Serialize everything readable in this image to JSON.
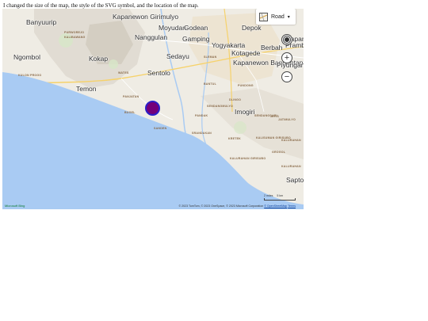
{
  "caption": "I changed the size of the map, the style of the SVG symbol, and the location of the map.",
  "map": {
    "style_picker_label": "Road",
    "labels": {
      "kapanewon_girimulyo": "Kapanewon Girimulyo",
      "banyuurip": "Banyuurip",
      "moyudan": "Moyudan",
      "godean": "Godean",
      "depok": "Depok",
      "kapanewon_partial": "Kapane",
      "nanggulan": "Nanggulan",
      "gamping": "Gamping",
      "yogyakarta": "Yogyakarta",
      "berbah": "Berbah",
      "prambanan_partial": "Pramba",
      "ngombol": "Ngombol",
      "kokap": "Kokap",
      "sedayu": "Sedayu",
      "kotagede": "Kotagede",
      "kapanewon_banguntapan": "Kapanewon Banguntapan",
      "piyungan_partial": "Piyungan",
      "sentolo": "Sentolo",
      "temon": "Temon",
      "imogiri": "Imogiri",
      "sapto_partial": "Sapto",
      "purworejo": "PURWOREJO",
      "kulon_progo": "KULON PROGO",
      "bantul": "BANTUL",
      "wates": "WATES",
      "panjatan": "PANJATAN",
      "bugel": "BUGEL",
      "pandak": "PANDAK",
      "sanden": "SANDEN",
      "srandakan": "SRANDAKAN",
      "kretek": "KRETEK",
      "pundong": "PUNDONG",
      "dlingo": "DLINGO",
      "jetis": "JETIS",
      "jatimulyo": "JATIMULYO",
      "kalisuman_girisubo": "KALISUMAN GIRISUBO",
      "kalurahan_girisubo": "KALURAHAN GIRISUBO",
      "kalurahan": "KALURAHAN",
      "kalurahan2": "KALURAHAN",
      "sleman": "SLEMAN",
      "kalibawang": "KALIBAWANG",
      "sendangsari": "SENDANGSARI",
      "grogol": "GROGOL",
      "sendangmulyo": "SENDANGMULYO"
    },
    "scale": {
      "miles": "2 miles",
      "km": "5 km"
    },
    "footer": {
      "logo": "Microsoft Bing",
      "copyright": "© 2023 TomTom, © 2023 OneSpace, © 2023 Microsoft Corporation",
      "osm": "© OpenStreetMap",
      "terms": "Terms"
    },
    "colors": {
      "marker_fill": "#74007a",
      "marker_stroke": "#2b1ec8",
      "water": "#a9cbf3"
    }
  }
}
